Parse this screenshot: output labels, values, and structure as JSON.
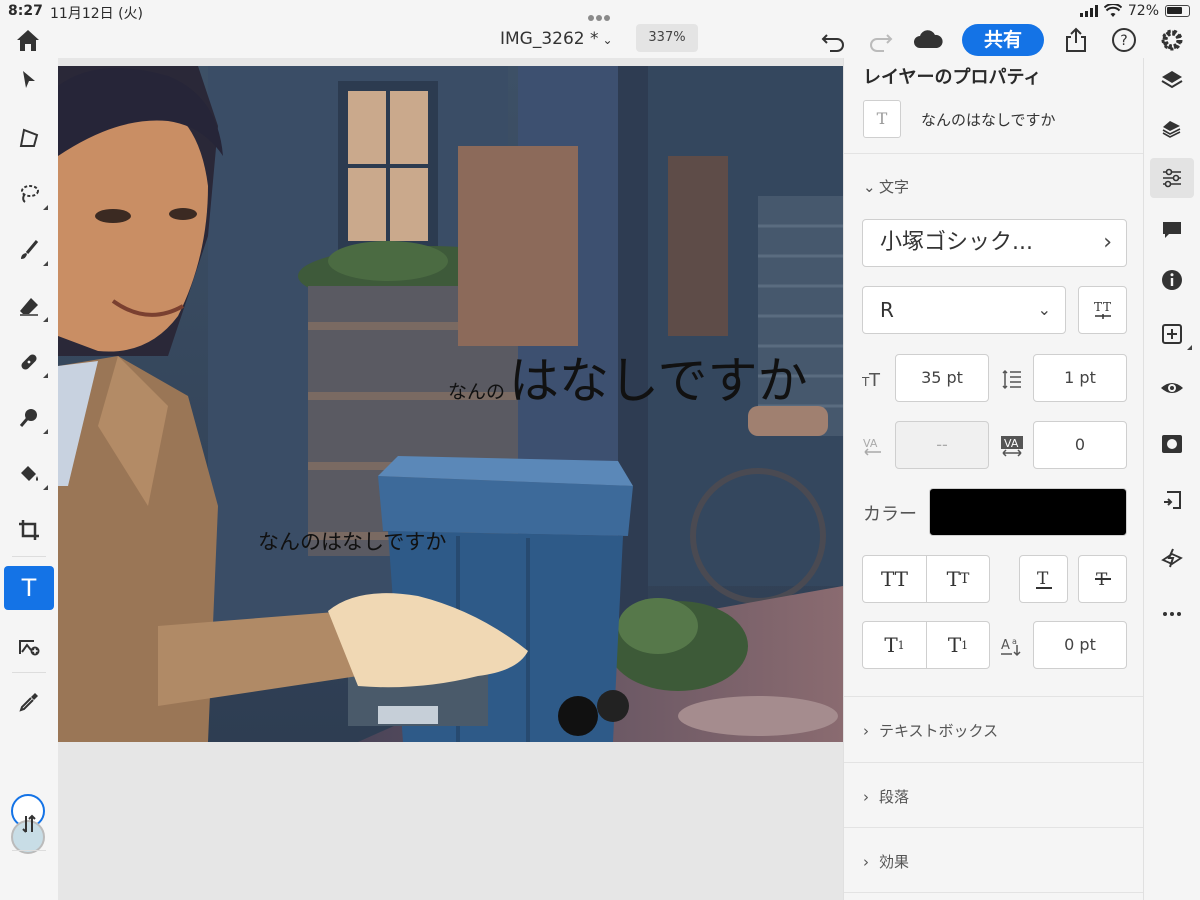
{
  "status": {
    "time": "8:27",
    "date": "11月12日 (火)",
    "battery": "72%"
  },
  "topbar": {
    "document_title": "IMG_3262 *",
    "zoom": "337%",
    "share_label": "共有"
  },
  "canvas": {
    "big_text_prefix": "なんの",
    "big_text_main": "はなしですか",
    "small_text": "なんのはなしですか"
  },
  "props": {
    "title": "レイヤーのプロパティ",
    "layer_thumb": "T",
    "layer_name": "なんのはなしですか",
    "section_text": "文字",
    "font_family": "小塚ゴシック...",
    "font_style": "R",
    "font_size": "35 pt",
    "leading": "1 pt",
    "kerning": "--",
    "tracking": "0",
    "color_label": "カラー",
    "baseline_shift": "0 pt",
    "text_color": "#000000",
    "section_textbox": "テキストボックス",
    "section_paragraph": "段落",
    "section_effects": "効果"
  },
  "colors": {
    "accent": "#1473e6",
    "foreground_swatch": "#ffffff",
    "background_swatch": "#c8dde6"
  }
}
